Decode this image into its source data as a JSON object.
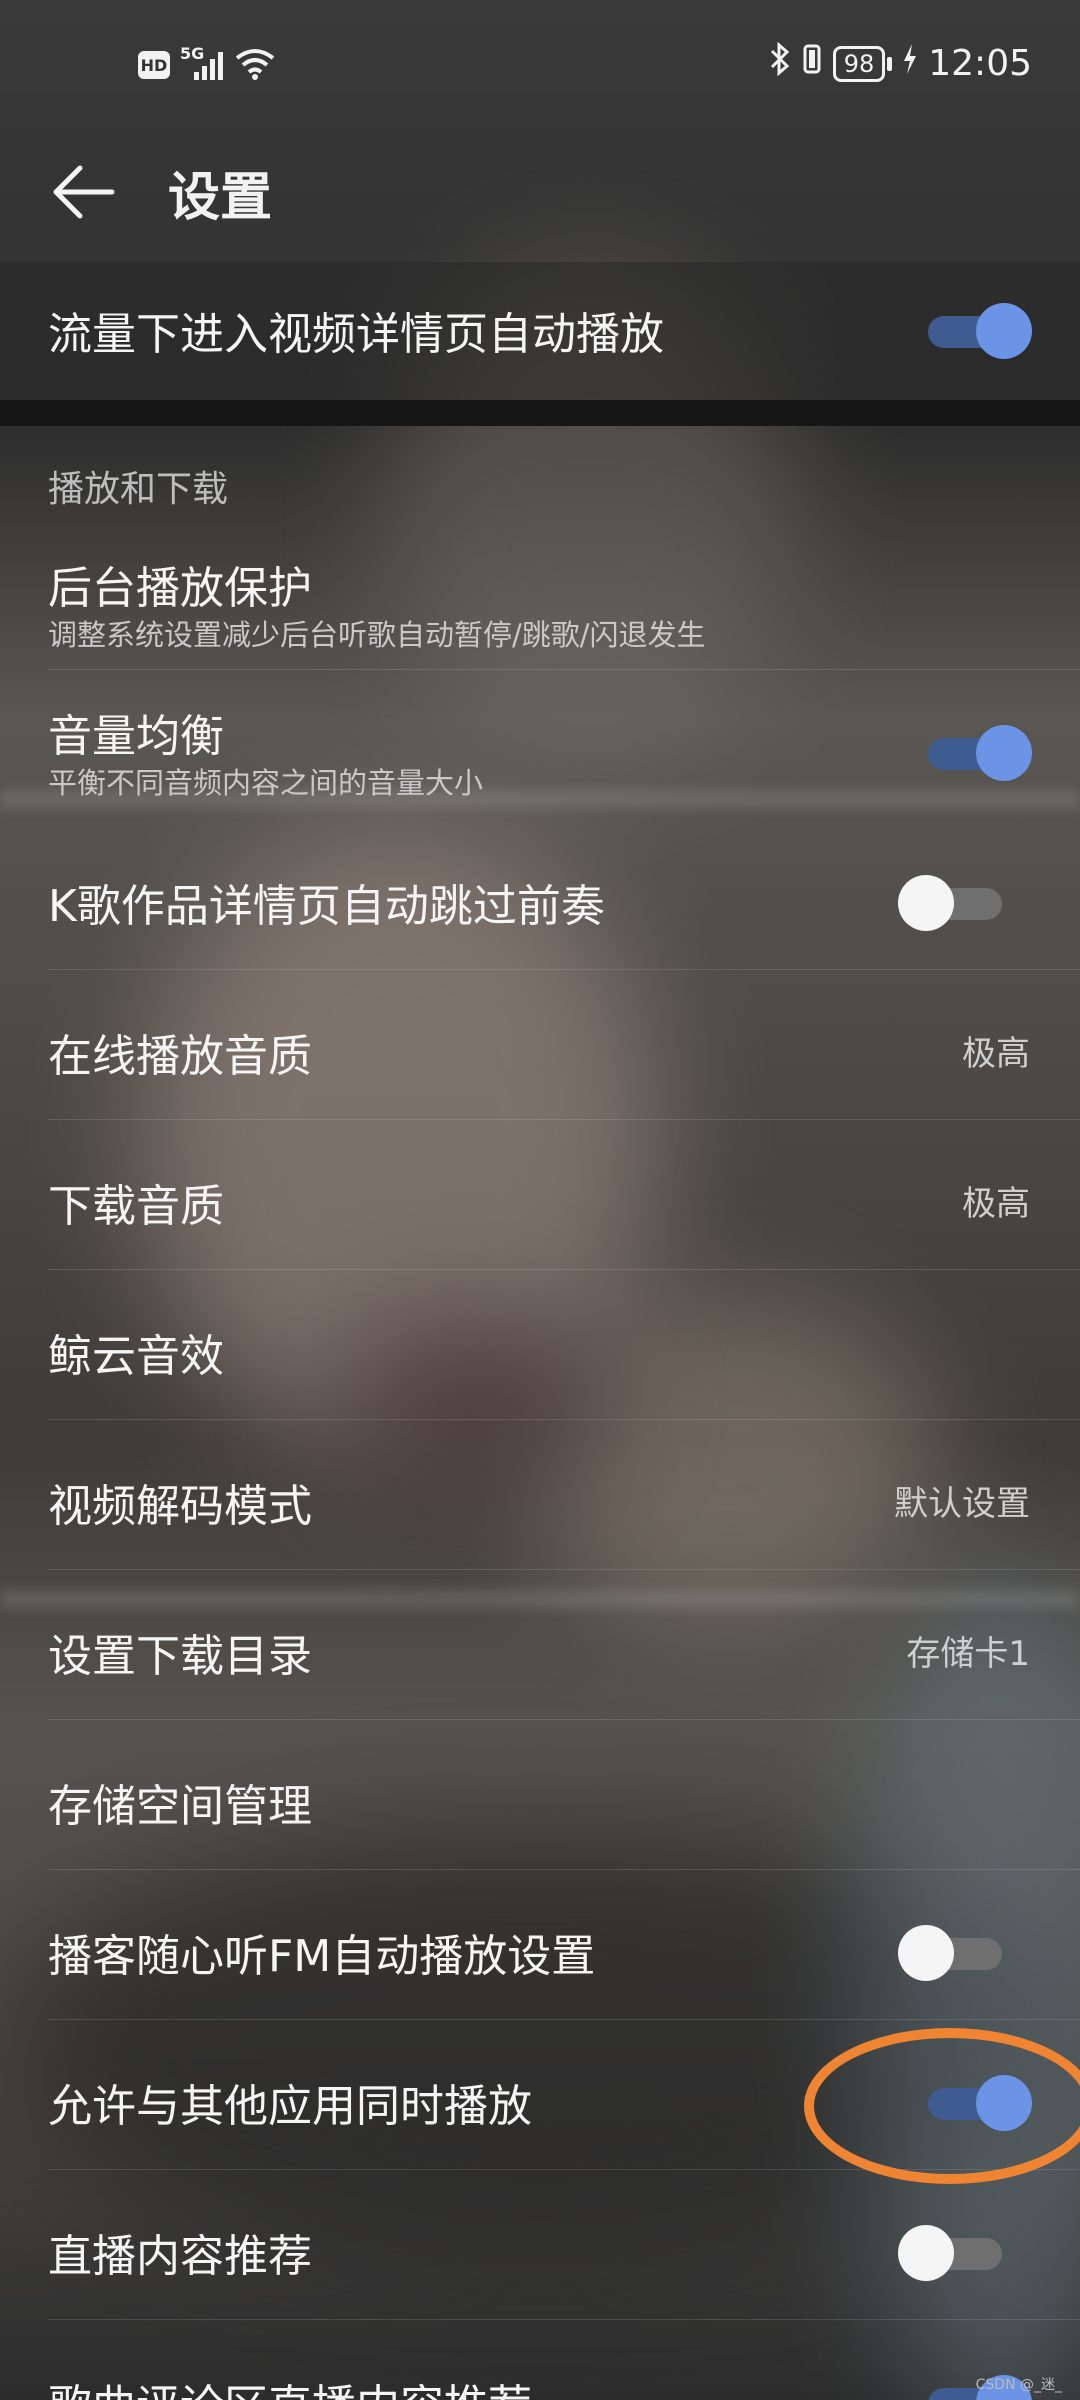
{
  "status_bar": {
    "hd_badge": "HD",
    "network": "5G",
    "battery": "98",
    "time": "12:05"
  },
  "header": {
    "title": "设置"
  },
  "top_toggle": {
    "label": "流量下进入视频详情页自动播放",
    "on": true
  },
  "section": {
    "title": "播放和下载"
  },
  "rows": [
    {
      "label": "后台播放保护",
      "subtitle": "调整系统设置减少后台听歌自动暂停/跳歌/闪退发生"
    },
    {
      "label": "音量均衡",
      "subtitle": "平衡不同音频内容之间的音量大小",
      "toggle": "on"
    },
    {
      "label": "K歌作品详情页自动跳过前奏",
      "toggle": "off"
    },
    {
      "label": "在线播放音质",
      "value": "极高"
    },
    {
      "label": "下载音质",
      "value": "极高"
    },
    {
      "label": "鲸云音效"
    },
    {
      "label": "视频解码模式",
      "value": "默认设置"
    },
    {
      "label": "设置下载目录",
      "value": "存储卡1"
    },
    {
      "label": "存储空间管理"
    },
    {
      "label": "播客随心听FM自动播放设置",
      "toggle": "off"
    },
    {
      "label": "允许与其他应用同时播放",
      "toggle": "on"
    },
    {
      "label": "直播内容推荐",
      "toggle": "off"
    },
    {
      "label": "歌曲评论区直播内容推荐",
      "toggle": "on"
    }
  ],
  "watermark": "CSDN @_迷_",
  "colors": {
    "toggle_on": "#6b93e6",
    "highlight_circle": "#ef8533"
  }
}
